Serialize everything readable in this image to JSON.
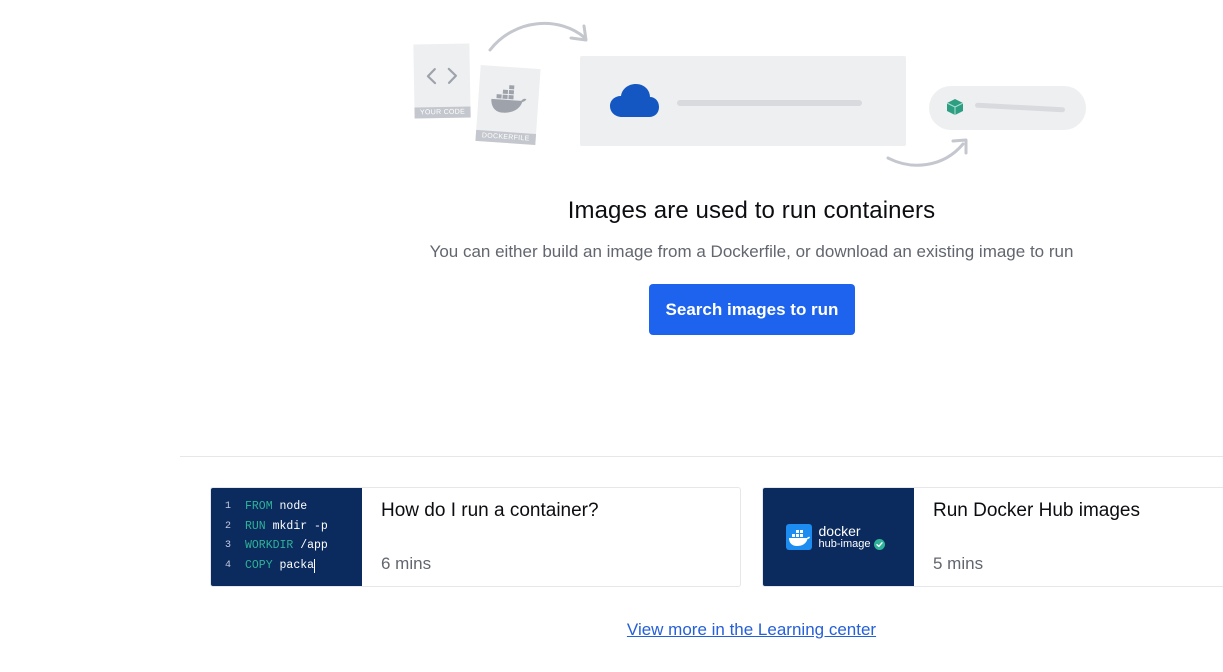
{
  "illustration": {
    "your_code_label": "YOUR CODE",
    "dockerfile_label": "DOCKERFILE"
  },
  "empty_state": {
    "title": "Images are used to run containers",
    "subtitle": "You can either build an image from a Dockerfile, or download an existing image to run",
    "button_label": "Search images to run"
  },
  "learning_cards": [
    {
      "title": "How do I run a container?",
      "duration": "6 mins",
      "code_lines": [
        {
          "num": "1",
          "keyword": "FROM",
          "rest": " node"
        },
        {
          "num": "2",
          "keyword": "RUN",
          "rest": " mkdir -p"
        },
        {
          "num": "3",
          "keyword": "WORKDIR",
          "rest": " /app"
        },
        {
          "num": "4",
          "keyword": "COPY",
          "rest": " packa"
        }
      ]
    },
    {
      "title": "Run Docker Hub images",
      "duration": "5 mins",
      "logo_word": "docker",
      "logo_sub": "hub-image"
    }
  ],
  "learn_more_link": "View more in the Learning center",
  "colors": {
    "primary": "#1d63ed",
    "thumb_bg": "#0b2a5d",
    "keyword": "#2eb398",
    "link": "#2560d9",
    "cloud": "#1557c2",
    "cube": "#2e9e82"
  },
  "icons": [
    "code-brackets-icon",
    "docker-whale-icon",
    "cloud-icon",
    "container-cube-icon",
    "curved-arrow-icon",
    "verified-check-icon"
  ]
}
